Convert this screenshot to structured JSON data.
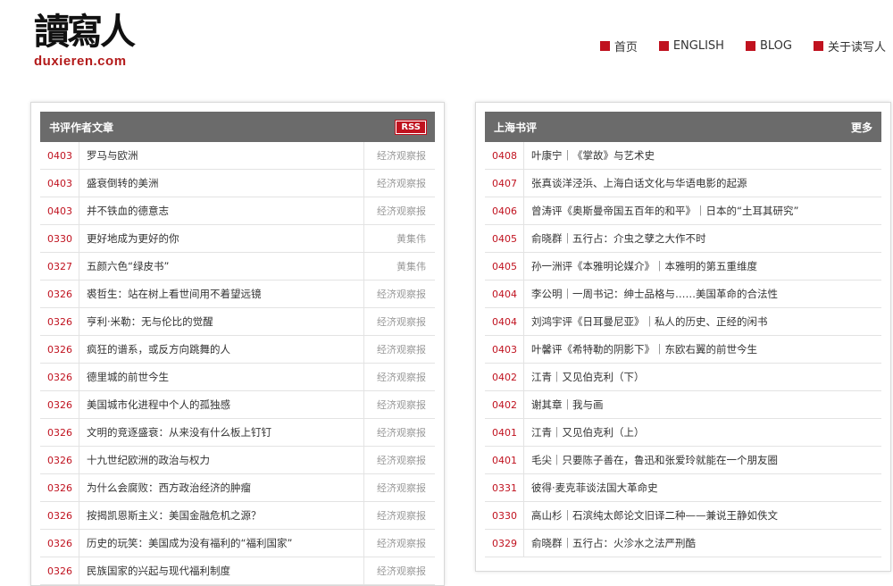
{
  "logo": {
    "chars": "讀寫人",
    "url": "duxieren.com"
  },
  "nav": [
    {
      "label": "首页"
    },
    {
      "label": "ENGLISH"
    },
    {
      "label": "BLOG"
    },
    {
      "label": "关于读写人"
    }
  ],
  "left_panel": {
    "title": "书评作者文章",
    "badge": "RSS",
    "rows": [
      {
        "date": "0403",
        "title": "罗马与欧洲",
        "source": "经济观察报"
      },
      {
        "date": "0403",
        "title": "盛衰倒转的美洲",
        "source": "经济观察报"
      },
      {
        "date": "0403",
        "title": "并不铁血的德意志",
        "source": "经济观察报"
      },
      {
        "date": "0330",
        "title": "更好地成为更好的你",
        "source": "黄集伟"
      },
      {
        "date": "0327",
        "title": "五颜六色“绿皮书”",
        "source": "黄集伟"
      },
      {
        "date": "0326",
        "title": "裘哲生：站在树上看世间用不着望远镜",
        "source": "经济观察报"
      },
      {
        "date": "0326",
        "title": "亨利·米勒：无与伦比的觉醒",
        "source": "经济观察报"
      },
      {
        "date": "0326",
        "title": "疯狂的谱系，或反方向跳舞的人",
        "source": "经济观察报"
      },
      {
        "date": "0326",
        "title": "德里城的前世今生",
        "source": "经济观察报"
      },
      {
        "date": "0326",
        "title": "美国城市化进程中个人的孤独感",
        "source": "经济观察报"
      },
      {
        "date": "0326",
        "title": "文明的竞逐盛衰：从来没有什么板上钉钉",
        "source": "经济观察报"
      },
      {
        "date": "0326",
        "title": "十九世纪欧洲的政治与权力",
        "source": "经济观察报"
      },
      {
        "date": "0326",
        "title": "为什么会腐败：西方政治经济的肿瘤",
        "source": "经济观察报"
      },
      {
        "date": "0326",
        "title": "按揭凯恩斯主义：美国金融危机之源？",
        "source": "经济观察报"
      },
      {
        "date": "0326",
        "title": "历史的玩笑：美国成为没有福利的“福利国家”",
        "source": "经济观察报"
      },
      {
        "date": "0326",
        "title": "民族国家的兴起与现代福利制度",
        "source": "经济观察报"
      }
    ]
  },
  "right_panel": {
    "title": "上海书评",
    "more": "更多",
    "rows": [
      {
        "date": "0408",
        "title": "叶康宁｜《掌故》与艺术史"
      },
      {
        "date": "0407",
        "title": "张真谈洋泾浜、上海白话文化与华语电影的起源"
      },
      {
        "date": "0406",
        "title": "曾涛评《奥斯曼帝国五百年的和平》｜日本的“土耳其研究”"
      },
      {
        "date": "0405",
        "title": "俞晓群｜五行占：介虫之孽之大作不时"
      },
      {
        "date": "0405",
        "title": "孙一洲评《本雅明论媒介》｜本雅明的第五重维度"
      },
      {
        "date": "0404",
        "title": "李公明｜一周书记：绅士品格与……美国革命的合法性"
      },
      {
        "date": "0404",
        "title": "刘鸿宇评《日耳曼尼亚》｜私人的历史、正经的闲书"
      },
      {
        "date": "0403",
        "title": "叶馨评《希特勒的阴影下》｜东欧右翼的前世今生"
      },
      {
        "date": "0402",
        "title": "江青｜又见伯克利（下）"
      },
      {
        "date": "0402",
        "title": "谢其章｜我与画"
      },
      {
        "date": "0401",
        "title": "江青｜又见伯克利（上）"
      },
      {
        "date": "0401",
        "title": "毛尖｜只要陈子善在，鲁迅和张爱玲就能在一个朋友圈"
      },
      {
        "date": "0331",
        "title": "彼得·麦克菲谈法国大革命史"
      },
      {
        "date": "0330",
        "title": "高山杉｜石滨纯太郎论文旧译二种——兼说王静如佚文"
      },
      {
        "date": "0329",
        "title": "俞晓群｜五行占：火沴水之法严刑酷"
      }
    ]
  },
  "colors": {
    "accent": "#c0121f",
    "header_bg": "#6b6b6b"
  }
}
